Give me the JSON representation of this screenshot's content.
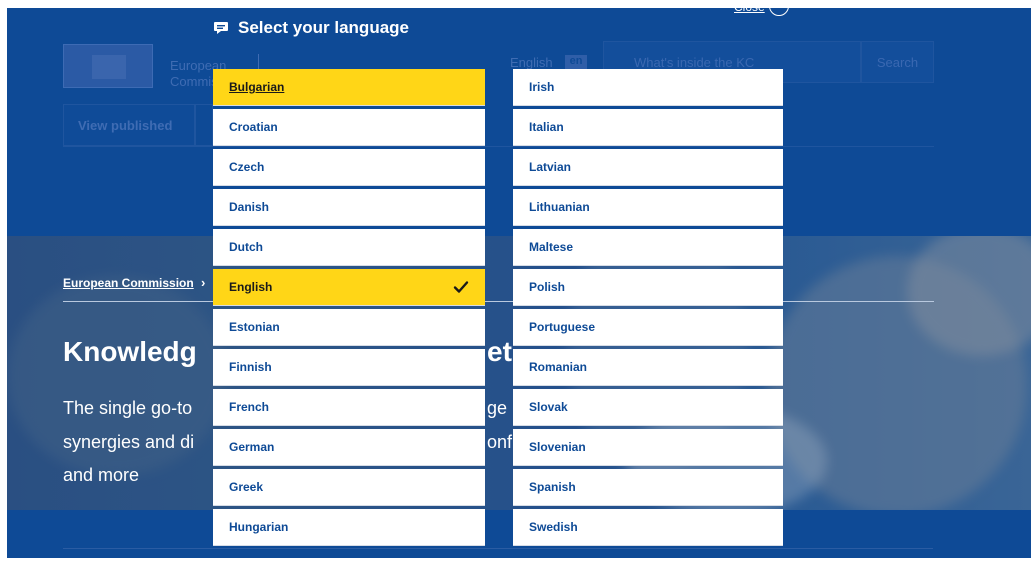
{
  "header": {
    "org_name_line1": "European",
    "org_name_line2": "Commission",
    "current_language": "English",
    "current_language_code": "en",
    "search_placeholder": "What's inside the KC",
    "search_button": "Search",
    "tab_published": "View published"
  },
  "hero": {
    "breadcrumb": "European Commission",
    "breadcrumb_separator": "›",
    "title_start": "Knowledg",
    "title_end": "et",
    "line1_start": "The single go-to",
    "line1_end": "ge",
    "line2_start": "synergies and di",
    "line2_end": "onf",
    "line3": "and more"
  },
  "overlay": {
    "title": "Select your language",
    "close_label": "Close",
    "close_icon": "×",
    "selected_language": "English",
    "focused_language": "Bulgarian",
    "left_column": [
      "Bulgarian",
      "Croatian",
      "Czech",
      "Danish",
      "Dutch",
      "English",
      "Estonian",
      "Finnish",
      "French",
      "German",
      "Greek",
      "Hungarian"
    ],
    "right_column": [
      "Irish",
      "Italian",
      "Latvian",
      "Lithuanian",
      "Maltese",
      "Polish",
      "Portuguese",
      "Romanian",
      "Slovak",
      "Slovenian",
      "Spanish",
      "Swedish"
    ]
  },
  "colors": {
    "brand_blue": "#0e4a96",
    "highlight_yellow": "#ffd617",
    "text_dark": "#1a1a1a",
    "white": "#ffffff"
  }
}
